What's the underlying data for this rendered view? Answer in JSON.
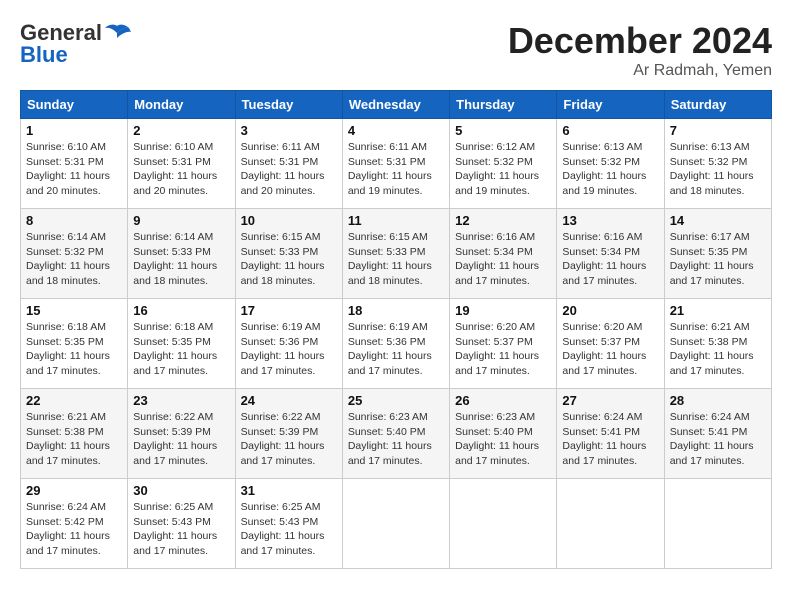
{
  "logo": {
    "general": "General",
    "blue": "Blue"
  },
  "header": {
    "month": "December 2024",
    "location": "Ar Radmah, Yemen"
  },
  "weekdays": [
    "Sunday",
    "Monday",
    "Tuesday",
    "Wednesday",
    "Thursday",
    "Friday",
    "Saturday"
  ],
  "weeks": [
    [
      {
        "day": "1",
        "sunrise": "Sunrise: 6:10 AM",
        "sunset": "Sunset: 5:31 PM",
        "daylight": "Daylight: 11 hours and 20 minutes."
      },
      {
        "day": "2",
        "sunrise": "Sunrise: 6:10 AM",
        "sunset": "Sunset: 5:31 PM",
        "daylight": "Daylight: 11 hours and 20 minutes."
      },
      {
        "day": "3",
        "sunrise": "Sunrise: 6:11 AM",
        "sunset": "Sunset: 5:31 PM",
        "daylight": "Daylight: 11 hours and 20 minutes."
      },
      {
        "day": "4",
        "sunrise": "Sunrise: 6:11 AM",
        "sunset": "Sunset: 5:31 PM",
        "daylight": "Daylight: 11 hours and 19 minutes."
      },
      {
        "day": "5",
        "sunrise": "Sunrise: 6:12 AM",
        "sunset": "Sunset: 5:32 PM",
        "daylight": "Daylight: 11 hours and 19 minutes."
      },
      {
        "day": "6",
        "sunrise": "Sunrise: 6:13 AM",
        "sunset": "Sunset: 5:32 PM",
        "daylight": "Daylight: 11 hours and 19 minutes."
      },
      {
        "day": "7",
        "sunrise": "Sunrise: 6:13 AM",
        "sunset": "Sunset: 5:32 PM",
        "daylight": "Daylight: 11 hours and 18 minutes."
      }
    ],
    [
      {
        "day": "8",
        "sunrise": "Sunrise: 6:14 AM",
        "sunset": "Sunset: 5:32 PM",
        "daylight": "Daylight: 11 hours and 18 minutes."
      },
      {
        "day": "9",
        "sunrise": "Sunrise: 6:14 AM",
        "sunset": "Sunset: 5:33 PM",
        "daylight": "Daylight: 11 hours and 18 minutes."
      },
      {
        "day": "10",
        "sunrise": "Sunrise: 6:15 AM",
        "sunset": "Sunset: 5:33 PM",
        "daylight": "Daylight: 11 hours and 18 minutes."
      },
      {
        "day": "11",
        "sunrise": "Sunrise: 6:15 AM",
        "sunset": "Sunset: 5:33 PM",
        "daylight": "Daylight: 11 hours and 18 minutes."
      },
      {
        "day": "12",
        "sunrise": "Sunrise: 6:16 AM",
        "sunset": "Sunset: 5:34 PM",
        "daylight": "Daylight: 11 hours and 17 minutes."
      },
      {
        "day": "13",
        "sunrise": "Sunrise: 6:16 AM",
        "sunset": "Sunset: 5:34 PM",
        "daylight": "Daylight: 11 hours and 17 minutes."
      },
      {
        "day": "14",
        "sunrise": "Sunrise: 6:17 AM",
        "sunset": "Sunset: 5:35 PM",
        "daylight": "Daylight: 11 hours and 17 minutes."
      }
    ],
    [
      {
        "day": "15",
        "sunrise": "Sunrise: 6:18 AM",
        "sunset": "Sunset: 5:35 PM",
        "daylight": "Daylight: 11 hours and 17 minutes."
      },
      {
        "day": "16",
        "sunrise": "Sunrise: 6:18 AM",
        "sunset": "Sunset: 5:35 PM",
        "daylight": "Daylight: 11 hours and 17 minutes."
      },
      {
        "day": "17",
        "sunrise": "Sunrise: 6:19 AM",
        "sunset": "Sunset: 5:36 PM",
        "daylight": "Daylight: 11 hours and 17 minutes."
      },
      {
        "day": "18",
        "sunrise": "Sunrise: 6:19 AM",
        "sunset": "Sunset: 5:36 PM",
        "daylight": "Daylight: 11 hours and 17 minutes."
      },
      {
        "day": "19",
        "sunrise": "Sunrise: 6:20 AM",
        "sunset": "Sunset: 5:37 PM",
        "daylight": "Daylight: 11 hours and 17 minutes."
      },
      {
        "day": "20",
        "sunrise": "Sunrise: 6:20 AM",
        "sunset": "Sunset: 5:37 PM",
        "daylight": "Daylight: 11 hours and 17 minutes."
      },
      {
        "day": "21",
        "sunrise": "Sunrise: 6:21 AM",
        "sunset": "Sunset: 5:38 PM",
        "daylight": "Daylight: 11 hours and 17 minutes."
      }
    ],
    [
      {
        "day": "22",
        "sunrise": "Sunrise: 6:21 AM",
        "sunset": "Sunset: 5:38 PM",
        "daylight": "Daylight: 11 hours and 17 minutes."
      },
      {
        "day": "23",
        "sunrise": "Sunrise: 6:22 AM",
        "sunset": "Sunset: 5:39 PM",
        "daylight": "Daylight: 11 hours and 17 minutes."
      },
      {
        "day": "24",
        "sunrise": "Sunrise: 6:22 AM",
        "sunset": "Sunset: 5:39 PM",
        "daylight": "Daylight: 11 hours and 17 minutes."
      },
      {
        "day": "25",
        "sunrise": "Sunrise: 6:23 AM",
        "sunset": "Sunset: 5:40 PM",
        "daylight": "Daylight: 11 hours and 17 minutes."
      },
      {
        "day": "26",
        "sunrise": "Sunrise: 6:23 AM",
        "sunset": "Sunset: 5:40 PM",
        "daylight": "Daylight: 11 hours and 17 minutes."
      },
      {
        "day": "27",
        "sunrise": "Sunrise: 6:24 AM",
        "sunset": "Sunset: 5:41 PM",
        "daylight": "Daylight: 11 hours and 17 minutes."
      },
      {
        "day": "28",
        "sunrise": "Sunrise: 6:24 AM",
        "sunset": "Sunset: 5:41 PM",
        "daylight": "Daylight: 11 hours and 17 minutes."
      }
    ],
    [
      {
        "day": "29",
        "sunrise": "Sunrise: 6:24 AM",
        "sunset": "Sunset: 5:42 PM",
        "daylight": "Daylight: 11 hours and 17 minutes."
      },
      {
        "day": "30",
        "sunrise": "Sunrise: 6:25 AM",
        "sunset": "Sunset: 5:43 PM",
        "daylight": "Daylight: 11 hours and 17 minutes."
      },
      {
        "day": "31",
        "sunrise": "Sunrise: 6:25 AM",
        "sunset": "Sunset: 5:43 PM",
        "daylight": "Daylight: 11 hours and 17 minutes."
      },
      null,
      null,
      null,
      null
    ]
  ]
}
